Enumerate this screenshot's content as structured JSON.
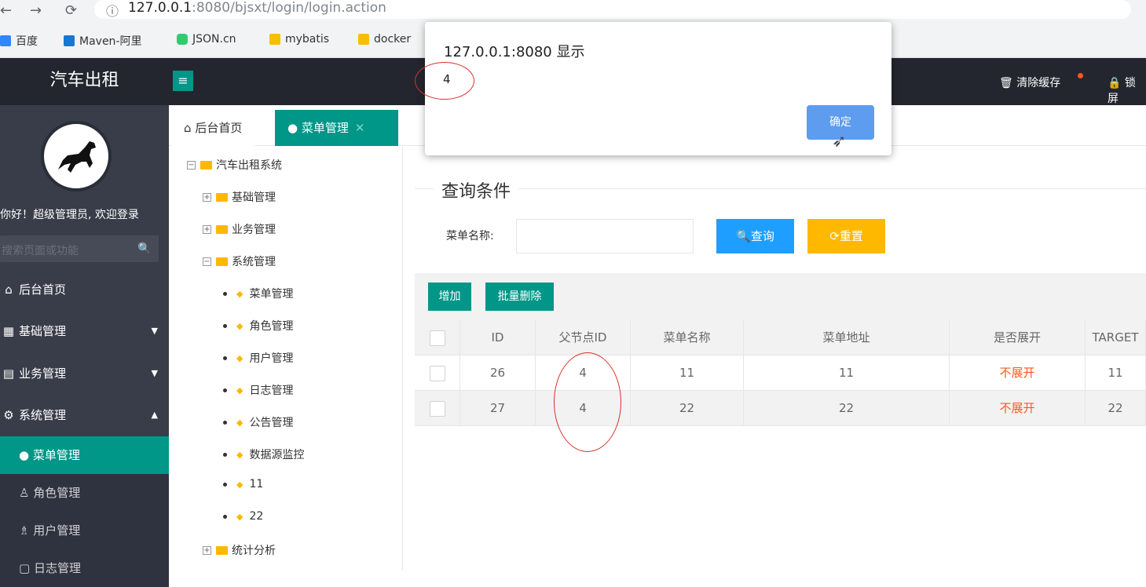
{
  "browser": {
    "url_prefix": "127.0.0.1",
    "url_rest": ":8080/bjsxt/login/login.action",
    "bookmarks": [
      "百度",
      "Maven-阿里",
      "JSON.cn",
      "mybatis",
      "docker"
    ]
  },
  "header": {
    "app_title": "汽车出租",
    "menu_toggle": "≡",
    "clear_cache": "清除缓存",
    "lock": "锁屏"
  },
  "sidebar": {
    "welcome": "你好！超级管理员, 欢迎登录",
    "search_placeholder": "搜索页面或功能",
    "items": [
      {
        "label": "后台首页",
        "icon": "⌂"
      },
      {
        "label": "基础管理",
        "icon": "▦",
        "arrow": "▼"
      },
      {
        "label": "业务管理",
        "icon": "▤",
        "arrow": "▼"
      },
      {
        "label": "系统管理",
        "icon": "⚙",
        "arrow": "▲"
      }
    ],
    "subitems": [
      {
        "label": "菜单管理",
        "icon": "●"
      },
      {
        "label": "角色管理",
        "icon": "♙"
      },
      {
        "label": "用户管理",
        "icon": "♗"
      },
      {
        "label": "日志管理",
        "icon": "▢"
      }
    ]
  },
  "tabs": {
    "home": "后台首页",
    "home_icon": "⌂",
    "menu": "菜单管理",
    "close": "✕"
  },
  "tree": {
    "root": "汽车出租系统",
    "nodes": [
      "基础管理",
      "业务管理",
      "系统管理",
      "统计分析"
    ],
    "leaves": [
      "菜单管理",
      "角色管理",
      "用户管理",
      "日志管理",
      "公告管理",
      "数据源监控",
      "11",
      "22"
    ]
  },
  "query": {
    "legend": "查询条件",
    "menu_name_label": "菜单名称:",
    "search_button": "查询",
    "reset_button": "重置"
  },
  "toolbar": {
    "add": "增加",
    "batch_delete": "批量删除"
  },
  "table": {
    "columns": [
      "ID",
      "父节点ID",
      "菜单名称",
      "菜单地址",
      "是否展开",
      "TARGET"
    ],
    "rows": [
      {
        "id": "26",
        "pid": "4",
        "name": "11",
        "url": "11",
        "spread": "不展开",
        "target": "11"
      },
      {
        "id": "27",
        "pid": "4",
        "name": "22",
        "url": "22",
        "spread": "不展开",
        "target": "22"
      }
    ]
  },
  "dialog": {
    "title": "127.0.0.1:8080 显示",
    "message": "4",
    "ok": "确定"
  },
  "colors": {
    "accent": "#009688",
    "primary": "#1e9fff",
    "warm": "#ffb800",
    "danger": "#ff5722",
    "dark": "#23262e",
    "annotation": "#d9302c"
  }
}
